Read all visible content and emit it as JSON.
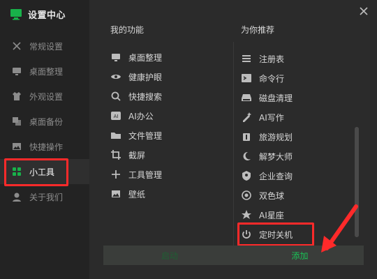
{
  "app": {
    "title": "设置中心",
    "brand_color": "#18b24a"
  },
  "sidebar": {
    "items": [
      {
        "label": "常规设置",
        "icon": "tools-icon"
      },
      {
        "label": "桌面整理",
        "icon": "monitor-icon"
      },
      {
        "label": "外观设置",
        "icon": "tshirt-icon"
      },
      {
        "label": "桌面备份",
        "icon": "copy-icon"
      },
      {
        "label": "快捷操作",
        "icon": "image-icon"
      },
      {
        "label": "小工具",
        "icon": "grid-icon",
        "active": true
      },
      {
        "label": "关于我们",
        "icon": "user-icon"
      }
    ]
  },
  "panel": {
    "my_functions_title": "我的功能",
    "recommended_title": "为你推荐",
    "my_functions": [
      {
        "label": "桌面整理",
        "icon": "monitor-icon"
      },
      {
        "label": "健康护眼",
        "icon": "eye-icon"
      },
      {
        "label": "快捷搜索",
        "icon": "search-icon"
      },
      {
        "label": "AI办公",
        "icon": "ai-badge-icon"
      },
      {
        "label": "文件管理",
        "icon": "folder-icon"
      },
      {
        "label": "截屏",
        "icon": "crop-icon"
      },
      {
        "label": "工具管理",
        "icon": "plus-icon"
      },
      {
        "label": "壁纸",
        "icon": "picture-icon"
      }
    ],
    "recommended": [
      {
        "label": "注册表",
        "icon": "registry-icon"
      },
      {
        "label": "命令行",
        "icon": "terminal-icon"
      },
      {
        "label": "磁盘清理",
        "icon": "disk-icon"
      },
      {
        "label": "AI写作",
        "icon": "pen-sparkle-icon"
      },
      {
        "label": "旅游规划",
        "icon": "luggage-icon"
      },
      {
        "label": "解梦大师",
        "icon": "moon-icon"
      },
      {
        "label": "企业查询",
        "icon": "shield-search-icon"
      },
      {
        "label": "双色球",
        "icon": "ball-icon"
      },
      {
        "label": "AI星座",
        "icon": "star-icon"
      },
      {
        "label": "定时关机",
        "icon": "power-icon"
      }
    ],
    "buttons": {
      "left": "启动",
      "right": "添加"
    }
  }
}
